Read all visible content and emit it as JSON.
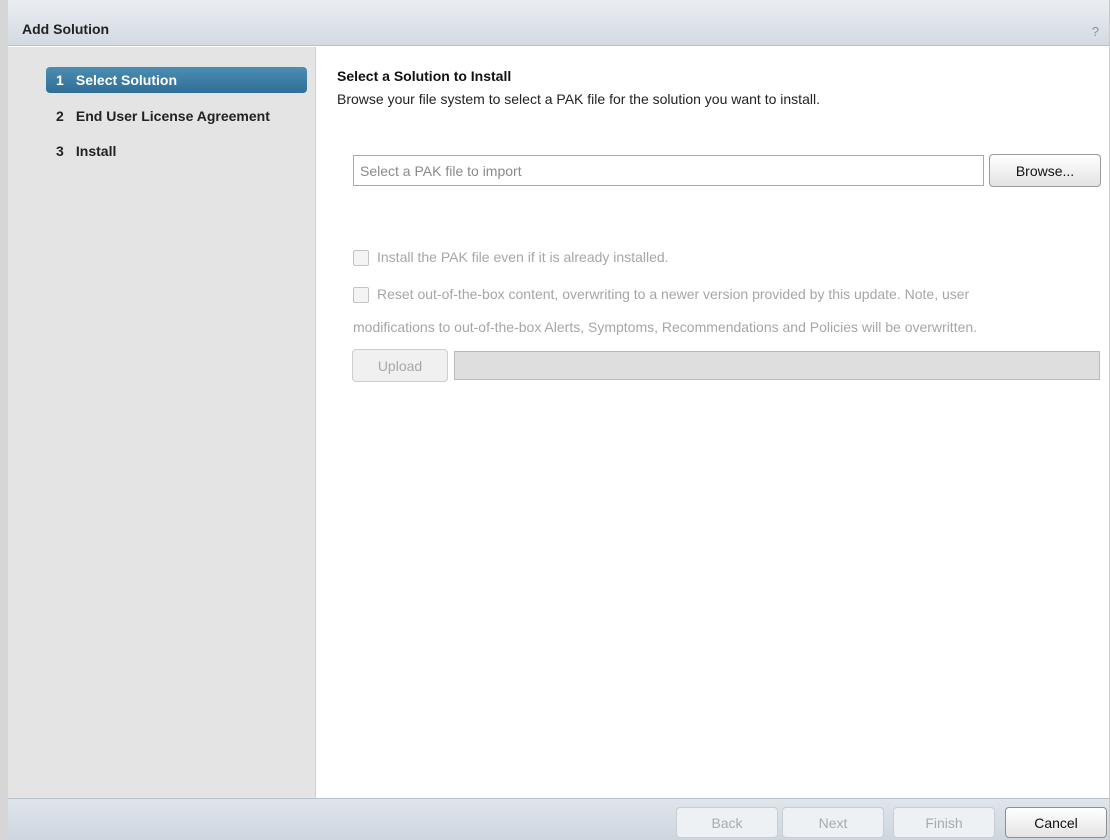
{
  "dialog": {
    "title": "Add Solution",
    "help_label": "?"
  },
  "steps": [
    {
      "number": "1",
      "label": "Select Solution",
      "active": true
    },
    {
      "number": "2",
      "label": "End User License Agreement",
      "active": false
    },
    {
      "number": "3",
      "label": "Install",
      "active": false
    }
  ],
  "main": {
    "heading": "Select a Solution to Install",
    "description": "Browse your file system to select a PAK file for the solution you want to install.",
    "file_input": {
      "value": "",
      "placeholder": "Select a PAK file to import"
    },
    "browse_label": "Browse...",
    "option_force_install": "Install the PAK file even if it is already installed.",
    "option_reset_line1": "Reset out-of-the-box content, overwriting to a newer version provided by this update. Note, user",
    "option_reset_line2": "modifications to out-of-the-box Alerts, Symptoms, Recommendations and Policies will be overwritten.",
    "upload_label": "Upload",
    "upload_progress": 0
  },
  "footer": {
    "back_label": "Back",
    "next_label": "Next",
    "finish_label": "Finish",
    "cancel_label": "Cancel"
  },
  "colors": {
    "active_step": "#3b7fa6",
    "sidebar_bg": "#e4e4e4",
    "titlebar_bg": "#d3dae2"
  }
}
